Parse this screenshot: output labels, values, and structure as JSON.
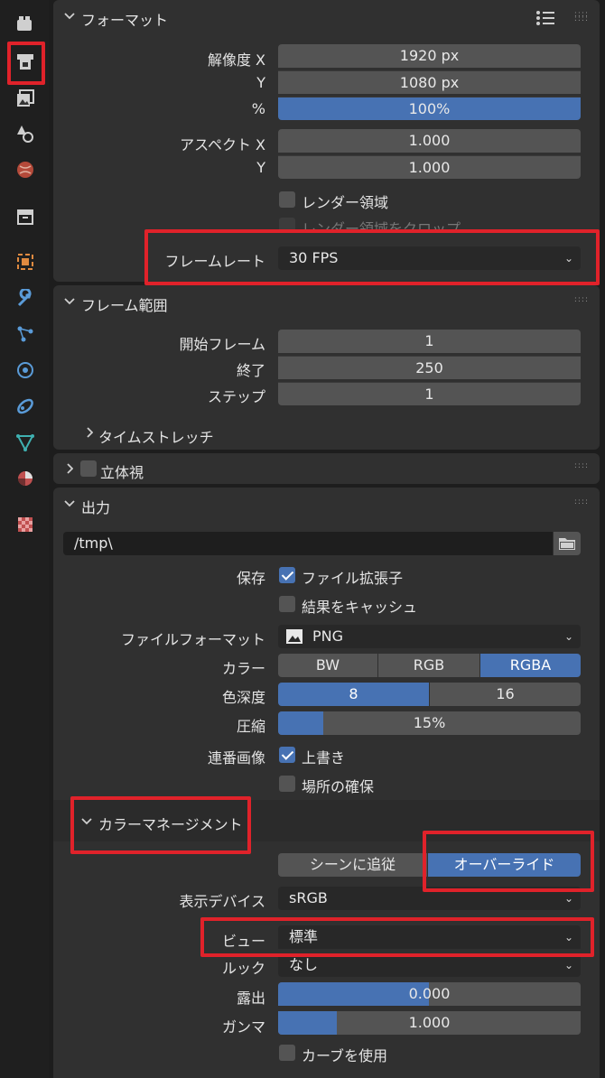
{
  "format": {
    "title": "フォーマット",
    "res_x_label": "解像度 X",
    "res_x": "1920 px",
    "res_y_label": "Y",
    "res_y": "1080 px",
    "percent_label": "%",
    "percent": "100%",
    "aspect_x_label": "アスペクト X",
    "aspect_x": "1.000",
    "aspect_y_label": "Y",
    "aspect_y": "1.000",
    "render_region": "レンダー領域",
    "crop_region": "レンダー領域をクロップ",
    "framerate_label": "フレームレート",
    "framerate": "30 FPS"
  },
  "frame_range": {
    "title": "フレーム範囲",
    "start_label": "開始フレーム",
    "start": "1",
    "end_label": "終了",
    "end": "250",
    "step_label": "ステップ",
    "step": "1",
    "time_stretch": "タイムストレッチ"
  },
  "stereoscopy": {
    "title": "立体視"
  },
  "output": {
    "title": "出力",
    "path": "/tmp\\",
    "save_label": "保存",
    "file_extensions": "ファイル拡張子",
    "cache_result": "結果をキャッシュ",
    "file_format_label": "ファイルフォーマット",
    "file_format": "PNG",
    "color_label": "カラー",
    "color_options": [
      "BW",
      "RGB",
      "RGBA"
    ],
    "color_selected": "RGBA",
    "depth_label": "色深度",
    "depth_options": [
      "8",
      "16"
    ],
    "compression_label": "圧縮",
    "compression": "15%",
    "compression_value": 0.15,
    "sequence_label": "連番画像",
    "overwrite": "上書き",
    "placeholders": "場所の確保"
  },
  "color_management": {
    "title": "カラーマネージメント",
    "follow_scene": "シーンに追従",
    "override": "オーバーライド",
    "display_device_label": "表示デバイス",
    "display_device": "sRGB",
    "view_label": "ビュー",
    "view": "標準",
    "look_label": "ルック",
    "look": "なし",
    "exposure_label": "露出",
    "exposure": "0.000",
    "gamma_label": "ガンマ",
    "gamma": "1.000",
    "use_curves": "カーブを使用"
  },
  "colors": {
    "accent": "#4772b3",
    "highlight": "#e0222a"
  }
}
